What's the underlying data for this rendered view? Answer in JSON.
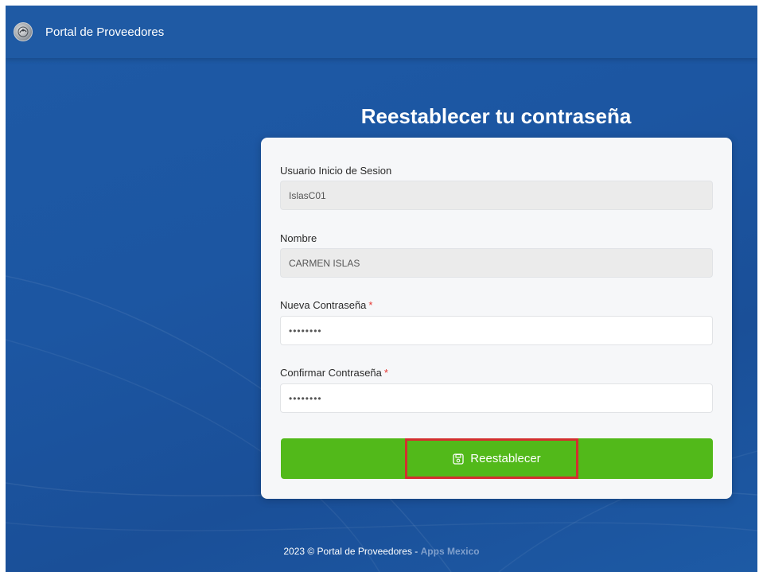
{
  "header": {
    "app_title": "Portal de Proveedores"
  },
  "form": {
    "heading": "Reestablecer tu contraseña",
    "username": {
      "label": "Usuario Inicio de Sesion",
      "value": "IslasC01"
    },
    "name": {
      "label": "Nombre",
      "value": "CARMEN ISLAS"
    },
    "new_password": {
      "label": "Nueva Contraseña",
      "required_mark": "*",
      "value": "••••••••"
    },
    "confirm_password": {
      "label": "Confirmar Contraseña",
      "required_mark": "*",
      "value": "••••••••"
    },
    "submit_label": "Reestablecer",
    "submit_icon": "save-icon"
  },
  "footer": {
    "text": "2023 © Portal de Proveedores - ",
    "link": "Apps Mexico"
  },
  "colors": {
    "background": "#1e5aa6",
    "button": "#52b91a",
    "highlight": "#d32f2f",
    "required": "#e53935"
  }
}
